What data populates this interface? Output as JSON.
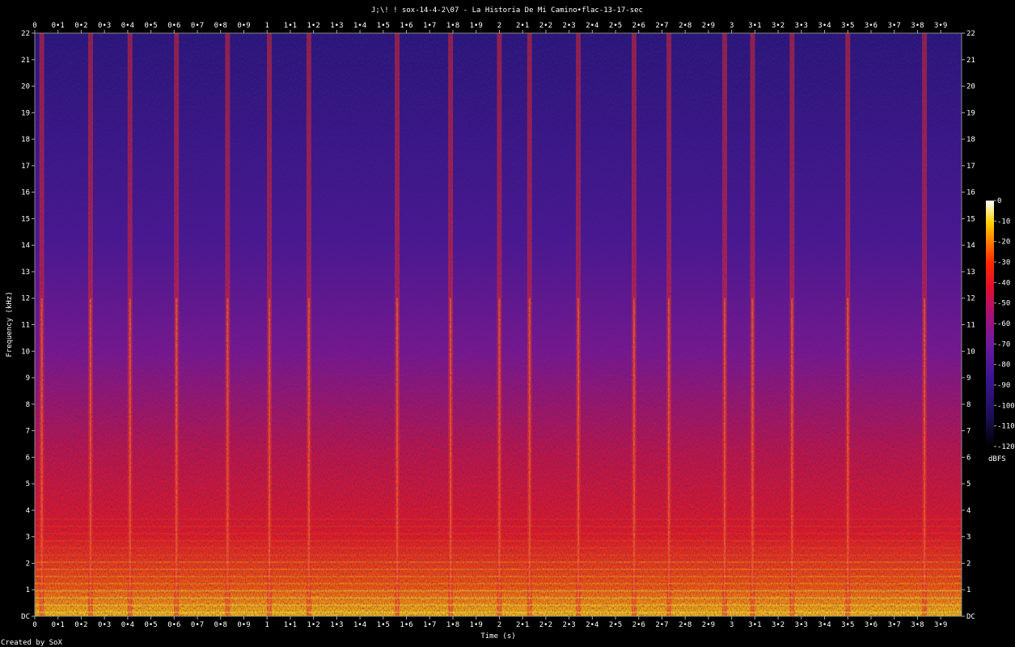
{
  "chart_data": {
    "type": "heatmap",
    "title": "J;\\! ! sox-14-4-2\\07 - La Historia De Mi Camino•flac-13-17-sec",
    "xlabel": "Time (s)",
    "ylabel": "Frequency (kHz)",
    "xlim": [
      0,
      3.99
    ],
    "ylim": [
      0,
      22
    ],
    "x_ticks": [
      "0",
      "0•1",
      "0•2",
      "0•3",
      "0•4",
      "0•5",
      "0•6",
      "0•7",
      "0•8",
      "0•9",
      "1",
      "1•1",
      "1•2",
      "1•3",
      "1•4",
      "1•5",
      "1•6",
      "1•7",
      "1•8",
      "1•9",
      "2",
      "2•1",
      "2•2",
      "2•3",
      "2•4",
      "2•5",
      "2•6",
      "2•7",
      "2•8",
      "2•9",
      "3",
      "3•1",
      "3•2",
      "3•3",
      "3•4",
      "3•5",
      "3•6",
      "3•7",
      "3•8",
      "3•9"
    ],
    "y_ticks": [
      "DC",
      "1",
      "2",
      "3",
      "4",
      "5",
      "6",
      "7",
      "8",
      "9",
      "10",
      "11",
      "12",
      "13",
      "14",
      "15",
      "16",
      "17",
      "18",
      "19",
      "20",
      "21",
      "22"
    ],
    "colorbar": {
      "label": "dBFS",
      "range": [
        -120,
        0
      ],
      "ticks": [
        "0",
        "-10",
        "-20",
        "-30",
        "-40",
        "-50",
        "-60",
        "-70",
        "-80",
        "-90",
        "-100",
        "-110",
        "-120"
      ]
    },
    "onsets_s": [
      0.03,
      0.24,
      0.41,
      0.61,
      0.83,
      1.01,
      1.18,
      1.56,
      1.79,
      2.0,
      2.13,
      2.34,
      2.58,
      2.73,
      2.97,
      3.09,
      3.26,
      3.5,
      3.83
    ],
    "grid": false,
    "footer": "Created by SoX"
  }
}
